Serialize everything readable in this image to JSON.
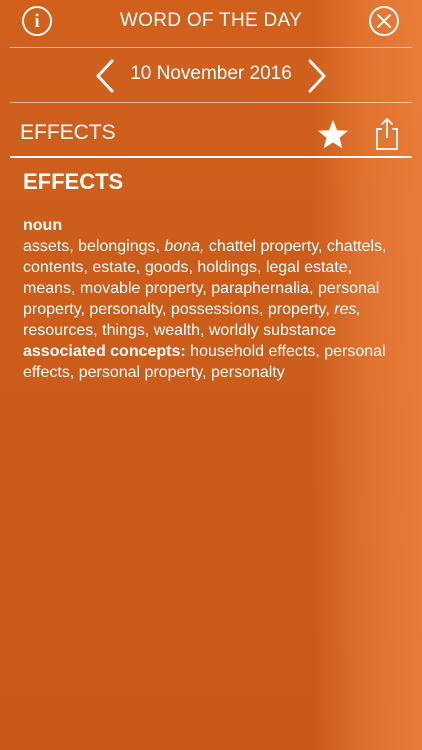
{
  "header": {
    "title": "WORD OF THE DAY",
    "info_icon_glyph": "i"
  },
  "date_nav": {
    "date": "10 November 2016"
  },
  "word_bar": {
    "word": "EFFECTS"
  },
  "entry": {
    "headword": "EFFECTS",
    "part_of_speech": "noun",
    "synonyms": [
      {
        "text": "assets, belongings, "
      },
      {
        "text": "bona,",
        "italic": true
      },
      {
        "text": " chattel property, chattels, contents, estate, goods, holdings, legal estate, means, movable property, paraphernalia, personal property, personalty, possessions, property, "
      },
      {
        "text": "res,",
        "italic": true
      },
      {
        "text": " resources, things, wealth, worldly substance"
      }
    ],
    "associated_label": "associated concepts:",
    "associated_text": " household effects, personal effects, personal property, personalty"
  },
  "colors": {
    "background": "#cc5c1a",
    "foreground": "#ffffff"
  },
  "icons": {
    "info": "info-icon",
    "close": "close-icon",
    "prev": "chevron-left-icon",
    "next": "chevron-right-icon",
    "favorite": "star-icon",
    "share": "share-icon"
  }
}
